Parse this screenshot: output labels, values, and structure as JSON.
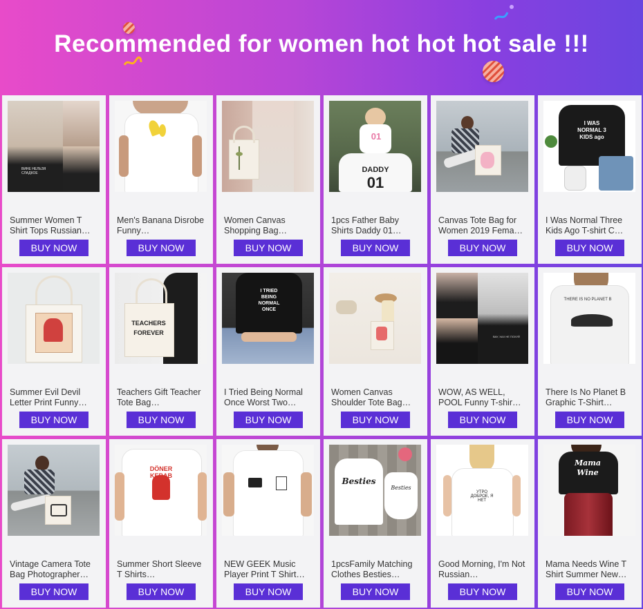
{
  "banner": {
    "title": "Recommended for women hot hot hot sale !!!"
  },
  "buy_label": "BUY NOW",
  "products": [
    {
      "title": "Summer Women T Shirt Tops Russian…",
      "image": "women-tshirt-russian-photo"
    },
    {
      "title": "Men's Banana Disrobe Funny…",
      "image": "banana-tshirt-photo"
    },
    {
      "title": "Women Canvas Shopping Bag…",
      "image": "canvas-shopping-bag-photo"
    },
    {
      "title": "1pcs Father Baby Shirts Daddy 01…",
      "image": "daddy-baby-shirts-photo"
    },
    {
      "title": "Canvas Tote Bag for Women 2019 Fema…",
      "image": "canvas-tote-bag-photo"
    },
    {
      "title": "I Was Normal Three Kids Ago T-shirt C…",
      "image": "three-kids-tshirt-photo"
    },
    {
      "title": "Summer Evil Devil Letter Print Funny…",
      "image": "evil-devil-bag-photo"
    },
    {
      "title": "Teachers Gift Teacher Tote Bag…",
      "image": "teacher-tote-bag-photo"
    },
    {
      "title": "I Tried Being Normal Once Worst Two…",
      "image": "tried-being-normal-photo"
    },
    {
      "title": "Women Canvas Shoulder Tote Bag…",
      "image": "shoulder-tote-bag-photo"
    },
    {
      "title": "WOW, AS WELL, POOL Funny T-shir…",
      "image": "wow-pool-tshirt-photo"
    },
    {
      "title": "There Is No Planet B Graphic T-Shirt…",
      "image": "no-planet-b-photo"
    },
    {
      "title": "Vintage Camera Tote Bag Photographer…",
      "image": "vintage-camera-bag-photo"
    },
    {
      "title": "Summer Short Sleeve T Shirts…",
      "image": "doner-kebab-tshirt-photo"
    },
    {
      "title": "NEW GEEK Music Player Print T Shirt…",
      "image": "geek-music-tshirt-photo"
    },
    {
      "title": "1pcsFamily Matching Clothes Besties…",
      "image": "besties-matching-photo"
    },
    {
      "title": "Good Morning, I'm Not Russian…",
      "image": "good-morning-tshirt-photo"
    },
    {
      "title": "Mama Needs Wine T Shirt Summer New…",
      "image": "mama-wine-tshirt-photo"
    }
  ],
  "image_text": {
    "daddy": "DADDY",
    "daddy_num": "01",
    "baby_num": "01",
    "three_kids": "I WAS NORMAL 3 KIDS ago",
    "tried_normal": "I TRIED BEING NORMAL ONCE",
    "teachers": "TEACHERS FOREVER",
    "doner": "DÖNER KEBAB",
    "besties": "Besties",
    "mama": "Mama Wine"
  },
  "colors": {
    "button": "#5a2fd6",
    "card": "#f3f3f5",
    "banner_text": "#ffffff"
  }
}
